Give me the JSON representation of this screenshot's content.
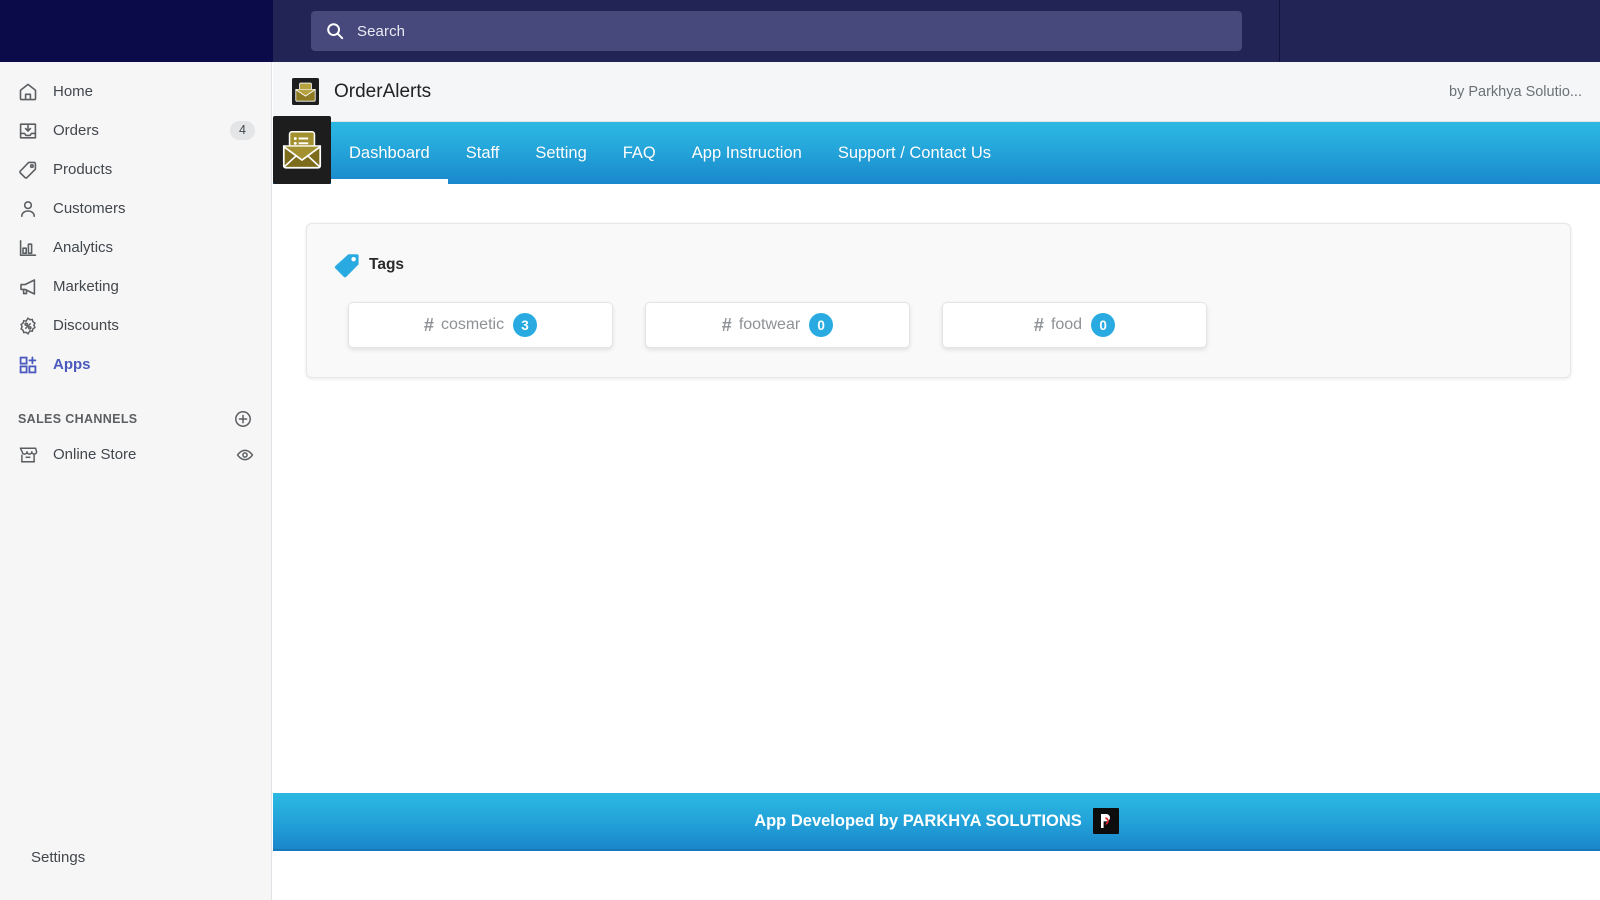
{
  "topbar": {
    "search": {
      "placeholder": "Search",
      "value": "",
      "icon": "search-icon"
    }
  },
  "sidebar": {
    "items": [
      {
        "label": "Home",
        "icon": "home-icon",
        "badge": null,
        "active": false
      },
      {
        "label": "Orders",
        "icon": "orders-icon",
        "badge": "4",
        "active": false
      },
      {
        "label": "Products",
        "icon": "products-icon",
        "badge": null,
        "active": false
      },
      {
        "label": "Customers",
        "icon": "customers-icon",
        "badge": null,
        "active": false
      },
      {
        "label": "Analytics",
        "icon": "analytics-icon",
        "badge": null,
        "active": false
      },
      {
        "label": "Marketing",
        "icon": "marketing-icon",
        "badge": null,
        "active": false
      },
      {
        "label": "Discounts",
        "icon": "discounts-icon",
        "badge": null,
        "active": false
      },
      {
        "label": "Apps",
        "icon": "apps-icon",
        "badge": null,
        "active": true
      }
    ],
    "sales_channels": {
      "title": "SALES CHANNELS",
      "add_icon": "plus-circle-icon",
      "items": [
        {
          "label": "Online Store",
          "icon": "storefront-icon",
          "action_icon": "eye-icon"
        }
      ]
    },
    "settings": {
      "label": "Settings",
      "icon": "gear-icon"
    }
  },
  "app_header": {
    "title": "OrderAlerts",
    "icon": "envelope-app-icon",
    "by_line": "by Parkhya Solutio..."
  },
  "tabbar": {
    "logo_icon": "envelope-app-icon",
    "tabs": [
      {
        "label": "Dashboard",
        "active": true
      },
      {
        "label": "Staff",
        "active": false
      },
      {
        "label": "Setting",
        "active": false
      },
      {
        "label": "FAQ",
        "active": false
      },
      {
        "label": "App Instruction",
        "active": false
      },
      {
        "label": "Support / Contact Us",
        "active": false
      }
    ]
  },
  "tags_card": {
    "title": "Tags",
    "icon": "price-tag-icon",
    "chips": [
      {
        "hash": "#",
        "name": "cosmetic",
        "count": "3"
      },
      {
        "hash": "#",
        "name": "footwear",
        "count": "0"
      },
      {
        "hash": "#",
        "name": "food",
        "count": "0"
      }
    ]
  },
  "footer": {
    "text": "App Developed by PARKHYA SOLUTIONS",
    "logo_icon": "parkhya-logo-icon"
  },
  "colors": {
    "topbar_dark": "#0c0b4a",
    "topbar": "#222456",
    "search_field": "#47487b",
    "sidebar_bg": "#f6f6f7",
    "accent_blue": "#29abe2",
    "tab_gradient_top": "#2cb9e2",
    "tab_gradient_bottom": "#1a88cc",
    "apps_active": "#4959bd"
  }
}
